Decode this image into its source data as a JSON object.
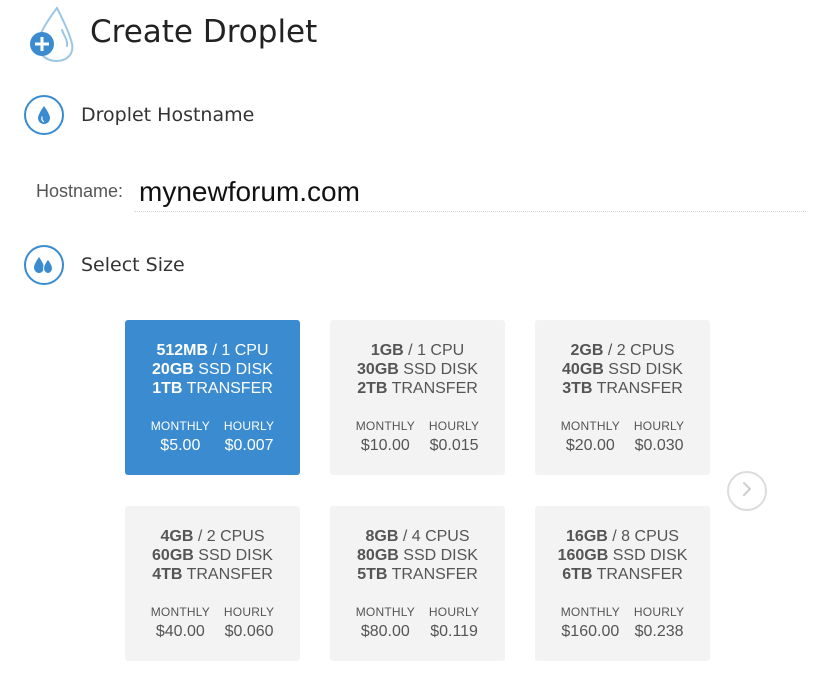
{
  "header": {
    "title": "Create Droplet",
    "icon": "droplet-plus-icon"
  },
  "hostname_section": {
    "title": "Droplet Hostname",
    "icon": "droplet-icon",
    "label": "Hostname:",
    "value": "mynewforum.com"
  },
  "size_section": {
    "title": "Select Size",
    "icon": "two-droplets-icon",
    "monthly_label": "MONTHLY",
    "hourly_label": "HOURLY",
    "sizes": [
      {
        "memory": "512MB",
        "cpu": "/ 1 CPU",
        "disk": "20GB",
        "disk_suffix": "SSD DISK",
        "transfer": "1TB",
        "transfer_suffix": "TRANSFER",
        "monthly": "$5.00",
        "hourly": "$0.007",
        "selected": true
      },
      {
        "memory": "1GB",
        "cpu": "/ 1 CPU",
        "disk": "30GB",
        "disk_suffix": "SSD DISK",
        "transfer": "2TB",
        "transfer_suffix": "TRANSFER",
        "monthly": "$10.00",
        "hourly": "$0.015",
        "selected": false
      },
      {
        "memory": "2GB",
        "cpu": "/ 2 CPUS",
        "disk": "40GB",
        "disk_suffix": "SSD DISK",
        "transfer": "3TB",
        "transfer_suffix": "TRANSFER",
        "monthly": "$20.00",
        "hourly": "$0.030",
        "selected": false
      },
      {
        "memory": "4GB",
        "cpu": "/ 2 CPUS",
        "disk": "60GB",
        "disk_suffix": "SSD DISK",
        "transfer": "4TB",
        "transfer_suffix": "TRANSFER",
        "monthly": "$40.00",
        "hourly": "$0.060",
        "selected": false
      },
      {
        "memory": "8GB",
        "cpu": "/ 4 CPUS",
        "disk": "80GB",
        "disk_suffix": "SSD DISK",
        "transfer": "5TB",
        "transfer_suffix": "TRANSFER",
        "monthly": "$80.00",
        "hourly": "$0.119",
        "selected": false
      },
      {
        "memory": "16GB",
        "cpu": "/ 8 CPUS",
        "disk": "160GB",
        "disk_suffix": "SSD DISK",
        "transfer": "6TB",
        "transfer_suffix": "TRANSFER",
        "monthly": "$160.00",
        "hourly": "$0.238",
        "selected": false
      }
    ],
    "next_icon": "chevron-right-icon"
  },
  "colors": {
    "accent": "#3a8bd0",
    "card_bg": "#f3f3f3",
    "text": "#555555"
  }
}
